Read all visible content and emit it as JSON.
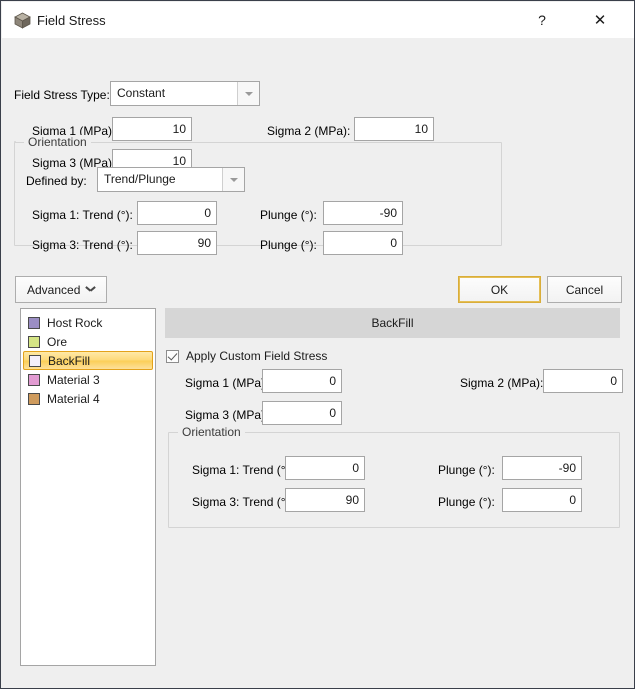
{
  "window": {
    "title": "Field Stress",
    "icon": "cube-icon",
    "help_label": "?",
    "close_label": "✕"
  },
  "main_form": {
    "type_label": "Field Stress Type:",
    "type_value": "Constant",
    "sigma1_label": "Sigma 1 (MPa):",
    "sigma1_value": "10",
    "sigma2_label": "Sigma 2 (MPa):",
    "sigma2_value": "10",
    "sigma3_label": "Sigma 3 (MPa):",
    "sigma3_value": "10",
    "orientation": {
      "title": "Orientation",
      "defined_by_label": "Defined by:",
      "defined_by_value": "Trend/Plunge",
      "sigma1_trend_label": "Sigma 1:  Trend (°):",
      "sigma1_trend_value": "0",
      "sigma1_plunge_label": "Plunge (°):",
      "sigma1_plunge_value": "-90",
      "sigma3_trend_label": "Sigma 3:  Trend (°):",
      "sigma3_trend_value": "90",
      "sigma3_plunge_label": "Plunge (°):",
      "sigma3_plunge_value": "0"
    }
  },
  "actions": {
    "advanced_label": "Advanced",
    "ok_label": "OK",
    "cancel_label": "Cancel"
  },
  "material_list": {
    "items": [
      {
        "label": "Host Rock",
        "color": "#9b8ec4",
        "selected": false
      },
      {
        "label": "Ore",
        "color": "#d5e585",
        "selected": false
      },
      {
        "label": "BackFill",
        "color": "#f4effa",
        "selected": true
      },
      {
        "label": "Material 3",
        "color": "#e29bd2",
        "selected": false
      },
      {
        "label": "Material 4",
        "color": "#cf9b5d",
        "selected": false
      }
    ]
  },
  "detail_panel": {
    "header": "BackFill",
    "apply_checkbox_label": "Apply Custom Field Stress",
    "apply_checked": true,
    "sigma1_label": "Sigma 1 (MPa):",
    "sigma1_value": "0",
    "sigma2_label": "Sigma 2 (MPa):",
    "sigma2_value": "0",
    "sigma3_label": "Sigma 3 (MPa):",
    "sigma3_value": "0",
    "orientation": {
      "title": "Orientation",
      "sigma1_trend_label": "Sigma 1:  Trend (°):",
      "sigma1_trend_value": "0",
      "sigma1_plunge_label": "Plunge (°):",
      "sigma1_plunge_value": "-90",
      "sigma3_trend_label": "Sigma 3:  Trend (°):",
      "sigma3_trend_value": "90",
      "sigma3_plunge_label": "Plunge (°):",
      "sigma3_plunge_value": "0"
    }
  },
  "theme": {
    "dialog_bg": "#efefef",
    "accent_focus": "#d9ad3a",
    "panel_header_bg": "#d6d6d6",
    "selection_gold": "#fcd濃"
  }
}
